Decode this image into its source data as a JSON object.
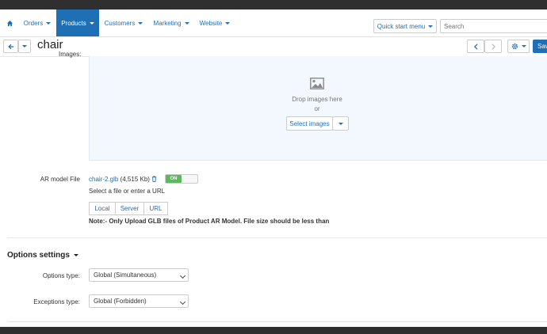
{
  "nav": {
    "items": [
      {
        "label": "Orders"
      },
      {
        "label": "Products"
      },
      {
        "label": "Customers"
      },
      {
        "label": "Marketing"
      },
      {
        "label": "Website"
      }
    ],
    "quick_start": "Quick start menu",
    "search_placeholder": "Search"
  },
  "page": {
    "title": "chair",
    "save_label": "Sav"
  },
  "images": {
    "label": "Images:",
    "drop_text": "Drop images here",
    "or_text": "or",
    "select_button": "Select images"
  },
  "ar_model": {
    "label": "AR model File",
    "file_name": "chair-2.glb",
    "file_size": "(4,515 Kb)",
    "toggle_label": "ON",
    "hint": "Select a file or enter a URL",
    "tabs": [
      "Local",
      "Server",
      "URL"
    ],
    "note": "Note:- Only Upload GLB files of Product AR Model. File size should be less than"
  },
  "options": {
    "section_title": "Options settings",
    "options_type_label": "Options type:",
    "options_type_value": "Global (Simultaneous)",
    "exceptions_type_label": "Exceptions type:",
    "exceptions_type_value": "Global (Forbidden)"
  },
  "colors": {
    "accent": "#1f6fb5",
    "toggle_on": "#5cb85c",
    "topbar": "#2f2f2f"
  }
}
